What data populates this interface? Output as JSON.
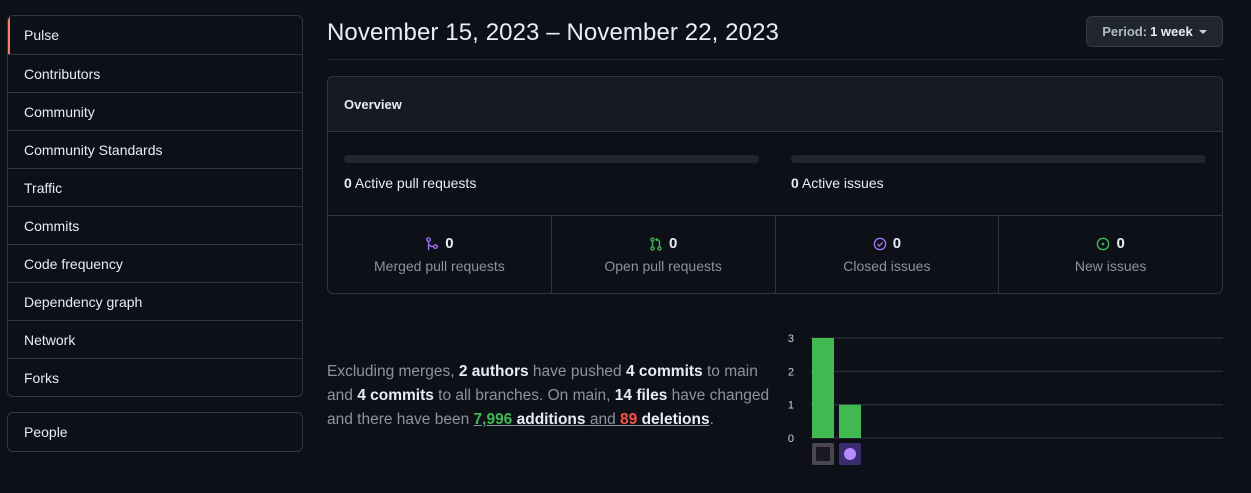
{
  "sidebar": {
    "items": [
      {
        "label": "Pulse",
        "selected": true
      },
      {
        "label": "Contributors"
      },
      {
        "label": "Community"
      },
      {
        "label": "Community Standards"
      },
      {
        "label": "Traffic"
      },
      {
        "label": "Commits"
      },
      {
        "label": "Code frequency"
      },
      {
        "label": "Dependency graph"
      },
      {
        "label": "Network"
      },
      {
        "label": "Forks"
      }
    ],
    "people_label": "People"
  },
  "header": {
    "date_range": "November 15, 2023 – November 22, 2023",
    "period_label": "Period:",
    "period_value": "1 week"
  },
  "overview": {
    "title": "Overview",
    "active_pr_count": "0",
    "active_pr_label": "Active pull requests",
    "active_issues_count": "0",
    "active_issues_label": "Active issues",
    "stats": [
      {
        "icon": "merge-icon",
        "value": "0",
        "label": "Merged pull requests",
        "color": "#a371f7"
      },
      {
        "icon": "pull-request-icon",
        "value": "0",
        "label": "Open pull requests",
        "color": "#3fb950"
      },
      {
        "icon": "issue-closed-icon",
        "value": "0",
        "label": "Closed issues",
        "color": "#a371f7"
      },
      {
        "icon": "issue-opened-icon",
        "value": "0",
        "label": "New issues",
        "color": "#3fb950"
      }
    ]
  },
  "summary": {
    "p1": "Excluding merges,",
    "authors": "2 authors",
    "p2": "have pushed",
    "commits_main": "4 commits",
    "p3": "to main and",
    "commits_all": "4 commits",
    "p4": "to all branches. On main,",
    "files": "14 files",
    "p5": "have changed and there have been",
    "additions_num": "7,996",
    "additions_word": "additions",
    "p6": "and",
    "deletions_num": "89",
    "deletions_word": "deletions",
    "p7": "."
  },
  "colors": {
    "accent": "#f78166",
    "bar": "#3fb950",
    "purple": "#a371f7",
    "green": "#3fb950",
    "red": "#f85149"
  },
  "chart_data": {
    "type": "bar",
    "categories": [
      "author-1",
      "author-2"
    ],
    "values": [
      3,
      1
    ],
    "ylim": [
      0,
      3
    ],
    "yticks": [
      "0",
      "1",
      "2",
      "3"
    ],
    "grid": true,
    "xlabel": "",
    "ylabel": "",
    "title": ""
  }
}
